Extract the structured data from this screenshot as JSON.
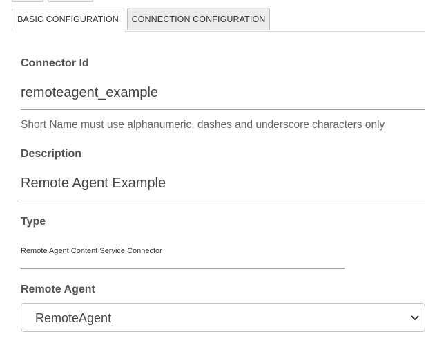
{
  "tabs": [
    {
      "label": "BASIC CONFIGURATION",
      "active": true
    },
    {
      "label": "CONNECTION CONFIGURATION",
      "active": false
    }
  ],
  "connector_id": {
    "label": "Connector Id",
    "value": "remoteagent_example",
    "hint": "Short Name must use alphanumeric, dashes and underscore characters only"
  },
  "description": {
    "label": "Description",
    "value": "Remote Agent Example"
  },
  "type": {
    "label": "Type",
    "value": "Remote Agent Content Service Connector"
  },
  "remote_agent": {
    "label": "Remote Agent",
    "selected": "RemoteAgent"
  },
  "icons": {
    "select_arrow": "chevron-down-icon"
  }
}
